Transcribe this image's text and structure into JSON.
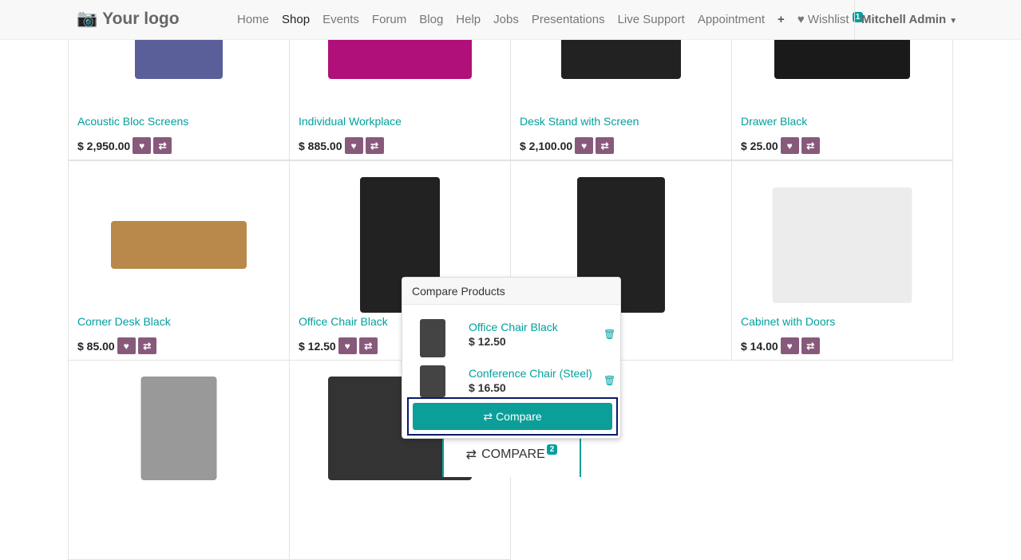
{
  "nav": {
    "logo": "Your logo",
    "items": [
      "Home",
      "Shop",
      "Events",
      "Forum",
      "Blog",
      "Help",
      "Jobs",
      "Presentations",
      "Live Support",
      "Appointment"
    ],
    "active": "Shop",
    "plus": "+",
    "wishlist": "Wishlist",
    "wishlist_count": "1",
    "user": "Mitchell Admin"
  },
  "products": [
    {
      "name": "Acoustic Bloc Screens",
      "price": "$ 2,950.00"
    },
    {
      "name": "Individual Workplace",
      "price": "$ 885.00"
    },
    {
      "name": "Desk Stand with Screen",
      "price": "$ 2,100.00"
    },
    {
      "name": "Drawer Black",
      "price": "$ 25.00"
    },
    {
      "name": "Corner Desk Black",
      "price": "$ 85.00"
    },
    {
      "name": "Office Chair Black",
      "price": "$ 12.50"
    },
    {
      "name": "Conference Chair",
      "price": "$ 16.50"
    },
    {
      "name": "Cabinet with Doors",
      "price": "$ 14.00"
    }
  ],
  "compare_popover": {
    "title": "Compare Products",
    "items": [
      {
        "name": "Office Chair Black",
        "price": "$ 12.50"
      },
      {
        "name": "Conference Chair (Steel)",
        "price": "$ 16.50"
      }
    ],
    "button": "Compare"
  },
  "compare_bar": {
    "label": "COMPARE",
    "count": "2"
  },
  "colors": {
    "accent": "#00a09d",
    "button": "#875a7b"
  }
}
